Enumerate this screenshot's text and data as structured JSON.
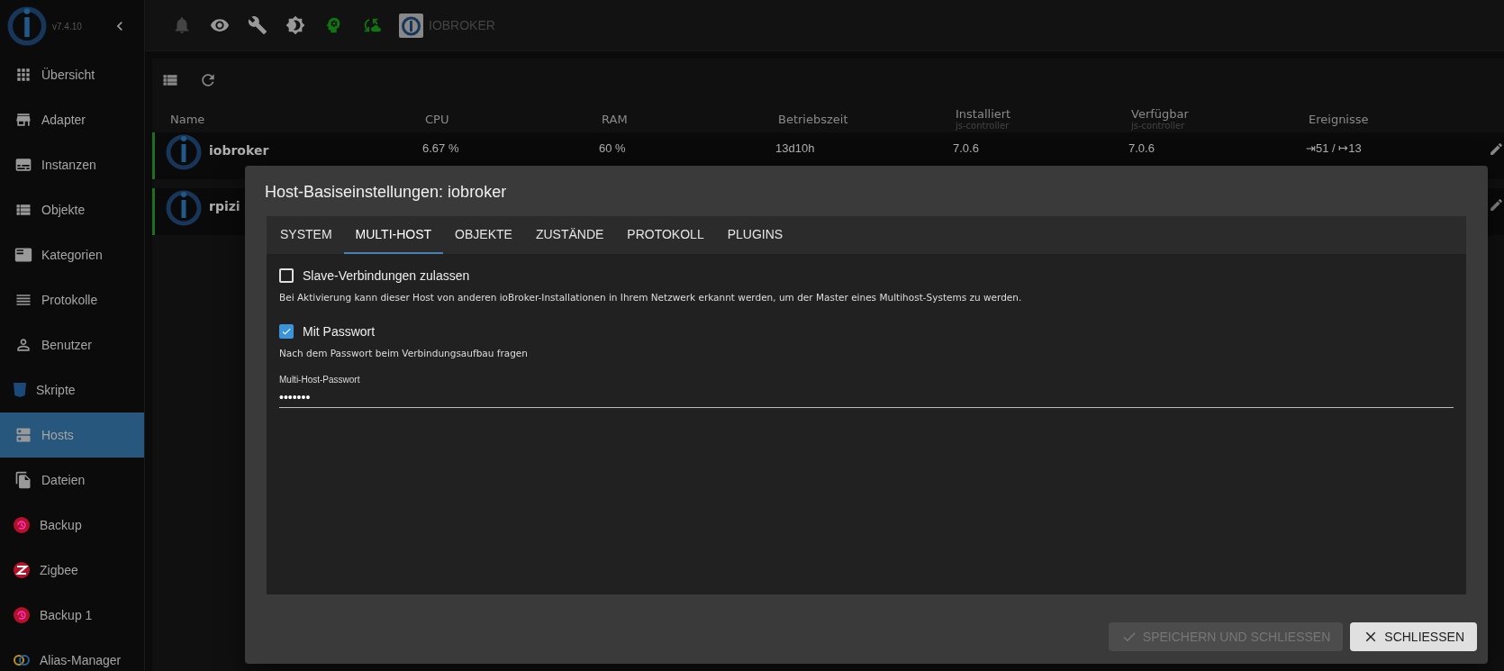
{
  "sidebar": {
    "version": "v7.4.10",
    "items": [
      {
        "label": "Übersicht",
        "selected": false
      },
      {
        "label": "Adapter",
        "selected": false
      },
      {
        "label": "Instanzen",
        "selected": false
      },
      {
        "label": "Objekte",
        "selected": false
      },
      {
        "label": "Kategorien",
        "selected": false
      },
      {
        "label": "Protokolle",
        "selected": false
      },
      {
        "label": "Benutzer",
        "selected": false
      },
      {
        "label": "Skripte",
        "selected": false
      },
      {
        "label": "Hosts",
        "selected": true
      },
      {
        "label": "Dateien",
        "selected": false
      },
      {
        "label": "Backup",
        "selected": false
      },
      {
        "label": "Zigbee",
        "selected": false
      },
      {
        "label": "Backup 1",
        "selected": false
      },
      {
        "label": "Alias-Manager",
        "selected": false
      }
    ]
  },
  "top_bar": {
    "title": "IOBROKER"
  },
  "table": {
    "columns": [
      {
        "label": "Name"
      },
      {
        "label": "CPU"
      },
      {
        "label": "RAM"
      },
      {
        "label": "Betriebszeit"
      },
      {
        "label": "Installiert",
        "sub": "js-controller"
      },
      {
        "label": "Verfügbar",
        "sub": "js-controller"
      },
      {
        "label": "Ereignisse"
      }
    ],
    "rows": [
      {
        "cells": [
          "iobroker",
          "6.67 %",
          "60 %",
          "13d10h",
          "7.0.6",
          "7.0.6",
          "⇥51 / ↦13"
        ]
      },
      {
        "cells": [
          "rpizi"
        ]
      }
    ]
  },
  "dialog": {
    "title": "Host-Basiseinstellungen: iobroker",
    "tabs": [
      {
        "label": "SYSTEM",
        "selected": false
      },
      {
        "label": "MULTI-HOST",
        "selected": true
      },
      {
        "label": "OBJEKTE",
        "selected": false
      },
      {
        "label": "ZUSTÄNDE",
        "selected": false
      },
      {
        "label": "PROTOKOLL",
        "selected": false
      },
      {
        "label": "PLUGINS",
        "selected": false
      }
    ],
    "options": [
      {
        "label": "Slave-Verbindungen zulassen",
        "checked": false,
        "description": "Bei Aktivierung kann dieser Host von anderen ioBroker-Installationen in Ihrem Netzwerk erkannt werden, um der Master eines Multihost-Systems zu werden."
      },
      {
        "label": "Mit Passwort",
        "checked": true,
        "description": "Nach dem Passwort beim Verbindungsaufbau fragen"
      }
    ],
    "password": {
      "label": "Multi-Host-Passwort",
      "value": "•••••••"
    },
    "buttons": [
      {
        "kind": "save",
        "label": "SPEICHERN UND SCHLIESSEN",
        "disabled": true
      },
      {
        "kind": "close",
        "label": "SCHLIESSEN",
        "disabled": false
      }
    ]
  }
}
